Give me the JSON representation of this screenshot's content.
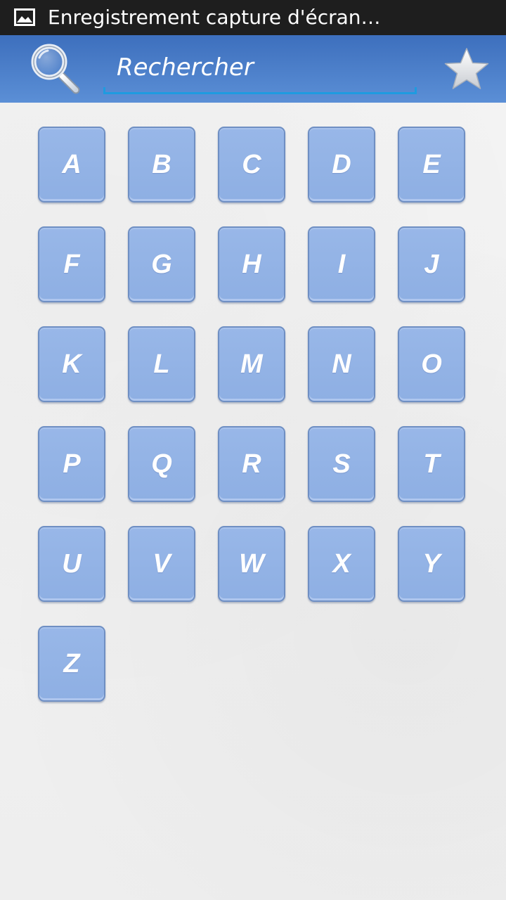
{
  "status_bar": {
    "notification_icon": "image-icon",
    "title": "Enregistrement capture d'écran…"
  },
  "header": {
    "search_icon": "search-icon",
    "search_placeholder": "Rechercher",
    "favorites_icon": "star-icon"
  },
  "letters": [
    "A",
    "B",
    "C",
    "D",
    "E",
    "F",
    "G",
    "H",
    "I",
    "J",
    "K",
    "L",
    "M",
    "N",
    "O",
    "P",
    "Q",
    "R",
    "S",
    "T",
    "U",
    "V",
    "W",
    "X",
    "Y",
    "Z"
  ],
  "colors": {
    "status_bar": "#1e1e1e",
    "header_top": "#3d6fbd",
    "header_bottom": "#5b8fd6",
    "search_underline": "#1e9be0",
    "letter_button": "#8eafe3",
    "background": "#f1f1f1"
  }
}
